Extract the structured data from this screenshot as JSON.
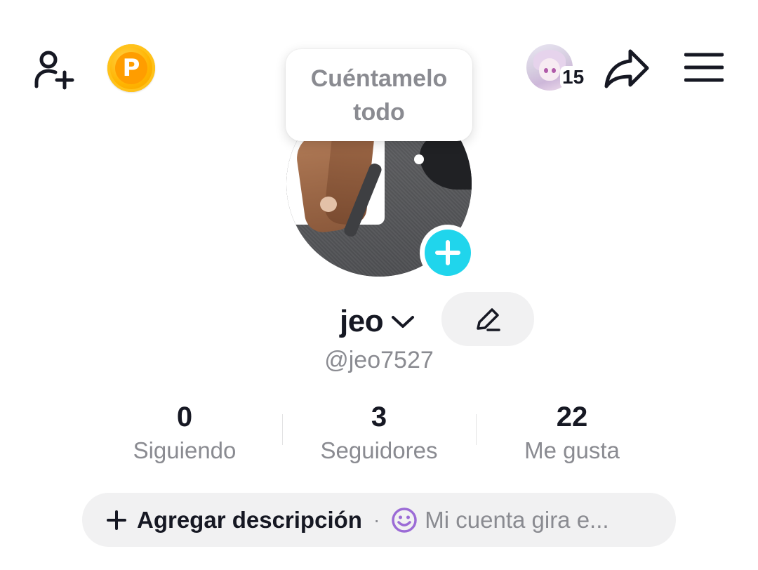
{
  "header": {
    "add_friend_icon": "person-add-icon",
    "coin_letter": "P",
    "friend_notification_count": "15",
    "share_icon": "share-arrow-icon",
    "menu_icon": "hamburger-menu-icon"
  },
  "tooltip": {
    "text": "Cuéntamelo todo"
  },
  "profile": {
    "display_name": "jeo",
    "username": "@jeo7527",
    "add_photo_icon": "plus-icon",
    "edit_icon": "pencil-icon"
  },
  "stats": [
    {
      "value": "0",
      "label": "Siguiendo"
    },
    {
      "value": "3",
      "label": "Seguidores"
    },
    {
      "value": "22",
      "label": "Me gusta"
    }
  ],
  "description": {
    "add_label": "Agregar descripción",
    "separator": "·",
    "status_text": "Mi cuenta gira e..."
  },
  "colors": {
    "accent": "#20d5ec",
    "coin": "#ffb400",
    "text_primary": "#161823",
    "text_secondary": "#8a8b91",
    "pill_bg": "#f1f1f2",
    "emoji": "#9b6bd6"
  }
}
